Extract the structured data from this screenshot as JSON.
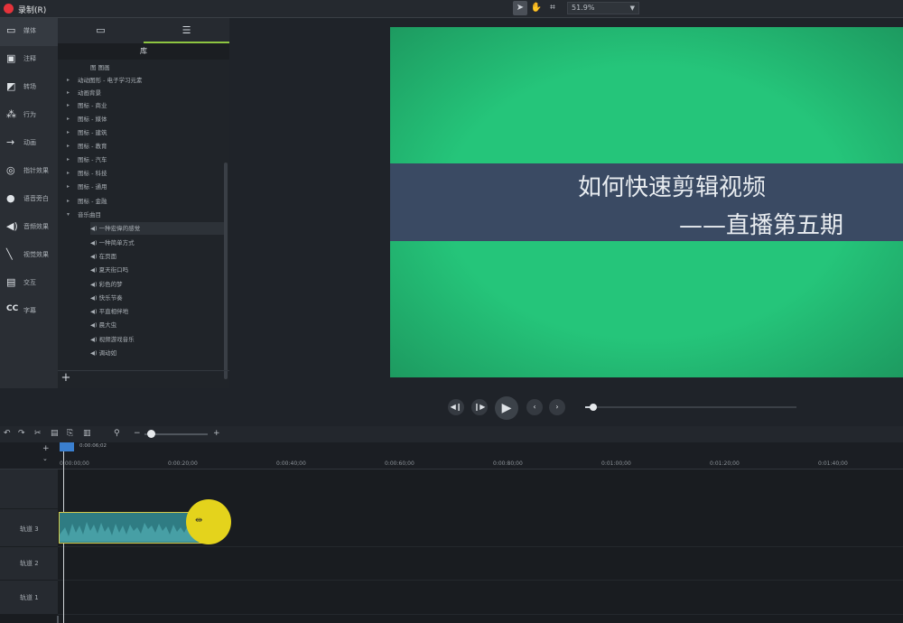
{
  "topbar": {
    "record_label": "录制(R)",
    "zoom": "51.9%",
    "tools": [
      "pointer-icon",
      "hand-icon",
      "crop-icon"
    ]
  },
  "nav": [
    {
      "icon": "media-icon",
      "label": "媒体"
    },
    {
      "icon": "annotation-icon",
      "label": "注释"
    },
    {
      "icon": "transition-icon",
      "label": "转场"
    },
    {
      "icon": "behavior-icon",
      "label": "行为"
    },
    {
      "icon": "animation-icon",
      "label": "动画"
    },
    {
      "icon": "cursor-effect-icon",
      "label": "指针效果"
    },
    {
      "icon": "voice-narration-icon",
      "label": "语音旁白"
    },
    {
      "icon": "audio-effect-icon",
      "label": "音频效果"
    },
    {
      "icon": "visual-effect-icon",
      "label": "视觉效果"
    },
    {
      "icon": "interactivity-icon",
      "label": "交互"
    },
    {
      "icon": "captions-icon",
      "label": "字幕"
    }
  ],
  "library": {
    "header": "库",
    "items": [
      {
        "label": "图 图画",
        "level": 1,
        "arrow": false
      },
      {
        "label": "动动图形 - 电子学习元素",
        "level": 0,
        "arrow": true
      },
      {
        "label": "动画背景",
        "level": 0,
        "arrow": true
      },
      {
        "label": "图标 - 商业",
        "level": 0,
        "arrow": true
      },
      {
        "label": "图标 - 媒体",
        "level": 0,
        "arrow": true
      },
      {
        "label": "图标 - 建筑",
        "level": 0,
        "arrow": true
      },
      {
        "label": "图标 - 教育",
        "level": 0,
        "arrow": true
      },
      {
        "label": "图标 - 汽车",
        "level": 0,
        "arrow": true
      },
      {
        "label": "图标 - 科技",
        "level": 0,
        "arrow": true
      },
      {
        "label": "图标 - 通用",
        "level": 0,
        "arrow": true
      },
      {
        "label": "图标 - 金融",
        "level": 0,
        "arrow": true
      },
      {
        "label": "音乐曲目",
        "level": 0,
        "arrow": true
      },
      {
        "label": "◀) 一种宏偉的感觉",
        "level": 1,
        "arrow": false
      },
      {
        "label": "◀) 一种简单方式",
        "level": 1,
        "arrow": false
      },
      {
        "label": "◀) 在页面",
        "level": 1,
        "arrow": false
      },
      {
        "label": "◀) 夏天街口吗",
        "level": 1,
        "arrow": false
      },
      {
        "label": "◀) 彩色的梦",
        "level": 1,
        "arrow": false
      },
      {
        "label": "◀) 快乐节奏",
        "level": 1,
        "arrow": false
      },
      {
        "label": "◀) 平直相伴地",
        "level": 1,
        "arrow": false
      },
      {
        "label": "◀) 晨大虫",
        "level": 1,
        "arrow": false
      },
      {
        "label": "◀) 视频游戏音乐",
        "level": 1,
        "arrow": false
      },
      {
        "label": "◀) 调动如",
        "level": 1,
        "arrow": false
      }
    ]
  },
  "canvas": {
    "title_line1": "如何快速剪辑视频",
    "title_line2": "——直播第五期"
  },
  "timeline": {
    "playhead_time": "0:00:06;02",
    "ticks": [
      "0:00:00;00",
      "0:00:20;00",
      "0:00:40;00",
      "0:00:60;00",
      "0:00:80;00",
      "0:01:00;00",
      "0:01:20;00",
      "0:01:40;00"
    ],
    "tracks": [
      "轨道 3",
      "轨道 2",
      "轨道 1"
    ]
  }
}
